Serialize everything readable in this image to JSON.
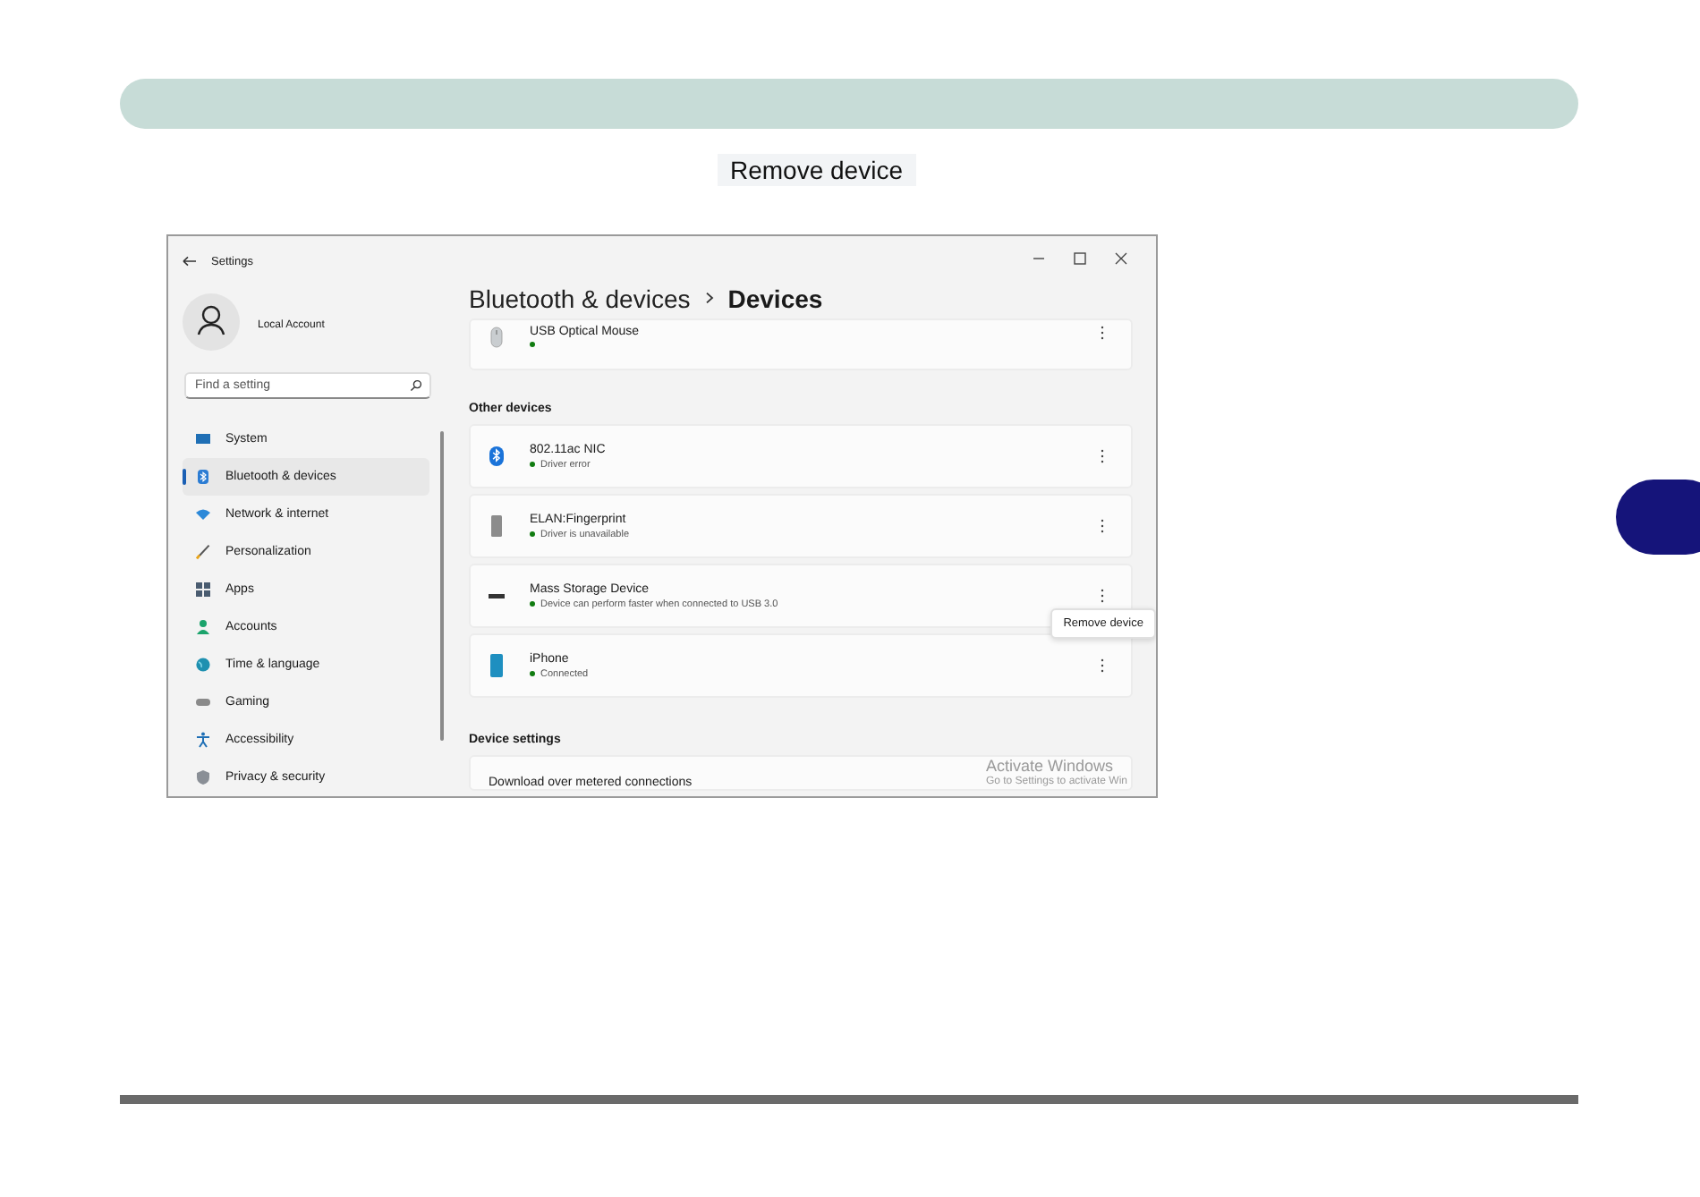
{
  "caption": "Remove device",
  "screenshot": {
    "window": {
      "title": "Settings"
    },
    "account": {
      "name": "Local Account"
    },
    "search": {
      "placeholder": "Find a setting"
    },
    "nav": [
      {
        "label": "System",
        "kind": "system",
        "selected": false
      },
      {
        "label": "Bluetooth & devices",
        "kind": "bluetooth",
        "selected": true
      },
      {
        "label": "Network & internet",
        "kind": "network",
        "selected": false
      },
      {
        "label": "Personalization",
        "kind": "brush",
        "selected": false
      },
      {
        "label": "Apps",
        "kind": "apps",
        "selected": false
      },
      {
        "label": "Accounts",
        "kind": "person",
        "selected": false
      },
      {
        "label": "Time & language",
        "kind": "globe",
        "selected": false
      },
      {
        "label": "Gaming",
        "kind": "gamepad",
        "selected": false
      },
      {
        "label": "Accessibility",
        "kind": "accessibility",
        "selected": false
      },
      {
        "label": "Privacy & security",
        "kind": "shield",
        "selected": false
      }
    ],
    "breadcrumb": {
      "parent": "Bluetooth & devices",
      "current": "Devices"
    },
    "top_devices": [
      {
        "name": "USB Optical Mouse",
        "kind": "mouse"
      }
    ],
    "other_devices": {
      "heading": "Other devices",
      "items": [
        {
          "name": "802.11ac NIC",
          "status": "Driver error",
          "kind": "bluetooth"
        },
        {
          "name": "ELAN:Fingerprint",
          "status": "Driver is unavailable",
          "kind": "fingerprint"
        },
        {
          "name": "Mass Storage Device",
          "status": "Device can perform faster when connected to USB 3.0",
          "kind": "storage",
          "tooltip": "Remove device"
        },
        {
          "name": "iPhone",
          "status": "Connected",
          "kind": "phone"
        }
      ]
    },
    "device_settings": {
      "heading": "Device settings",
      "items": [
        "Download over metered connections"
      ]
    },
    "activation_notice": {
      "title": "Activate Windows",
      "text": "Go to Settings to activate Win"
    }
  }
}
